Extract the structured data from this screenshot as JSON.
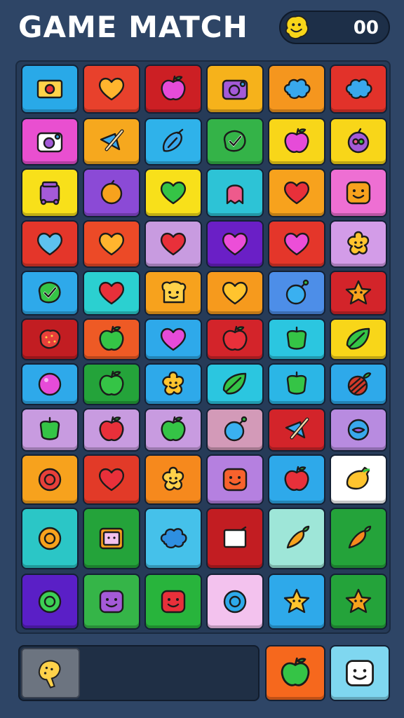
{
  "header": {
    "title": "GAME MATCH",
    "score": "00"
  },
  "colors": {
    "background": "#2e4566",
    "board": "#263b58",
    "text": "#ffffff"
  },
  "board": {
    "rows": [
      [
        {
          "bg": "#29a9e8",
          "icon": "ticket",
          "fg": "#ffd24a"
        },
        {
          "bg": "#e8412c",
          "icon": "heart",
          "fg": "#ffb52e"
        },
        {
          "bg": "#cc1f24",
          "icon": "apple",
          "fg": "#e64bd8"
        },
        {
          "bg": "#f6b21b",
          "icon": "camera",
          "fg": "#a45ad8"
        },
        {
          "bg": "#f5961e",
          "icon": "cloud",
          "fg": "#39a8ec"
        },
        {
          "bg": "#e2322a",
          "icon": "cloud",
          "fg": "#39a8ec"
        }
      ],
      [
        {
          "bg": "#e94fd0",
          "icon": "camera",
          "fg": "#ffffff"
        },
        {
          "bg": "#f6a81e",
          "icon": "brush",
          "fg": "#39a8ec"
        },
        {
          "bg": "#2fb2ea",
          "icon": "bulb",
          "fg": "#39a8ec"
        },
        {
          "bg": "#34b348",
          "icon": "check",
          "fg": "#34b348"
        },
        {
          "bg": "#f8d619",
          "icon": "apple",
          "fg": "#e64bd8"
        },
        {
          "bg": "#f8d619",
          "icon": "plum",
          "fg": "#a45ad8"
        }
      ],
      [
        {
          "bg": "#f8e01a",
          "icon": "bag",
          "fg": "#a45ad8"
        },
        {
          "bg": "#8b4ad6",
          "icon": "orange",
          "fg": "#f7a21d"
        },
        {
          "bg": "#f8e01a",
          "icon": "heart",
          "fg": "#35c446"
        },
        {
          "bg": "#2dc3d6",
          "icon": "ghost",
          "fg": "#ee5a8c"
        },
        {
          "bg": "#f7a21d",
          "icon": "heart",
          "fg": "#e8303a"
        },
        {
          "bg": "#ee6fd3",
          "icon": "face",
          "fg": "#f7a21d"
        }
      ],
      [
        {
          "bg": "#e4362a",
          "icon": "heart",
          "fg": "#5dc1ef"
        },
        {
          "bg": "#ec4a27",
          "icon": "heart",
          "fg": "#ffb52e"
        },
        {
          "bg": "#c89be0",
          "icon": "heart",
          "fg": "#e8303a"
        },
        {
          "bg": "#6a1fc6",
          "icon": "heart",
          "fg": "#ec4ed8"
        },
        {
          "bg": "#e4362a",
          "icon": "heart",
          "fg": "#ec4ed8"
        },
        {
          "bg": "#d39ce8",
          "icon": "flower",
          "fg": "#ffc42e"
        }
      ],
      [
        {
          "bg": "#2ea9ea",
          "icon": "check",
          "fg": "#35c446"
        },
        {
          "bg": "#2bd0d0",
          "icon": "heart",
          "fg": "#e8303a"
        },
        {
          "bg": "#f7a21d",
          "icon": "toast",
          "fg": "#ffd24a"
        },
        {
          "bg": "#f69a1d",
          "icon": "heart",
          "fg": "#ffc42e"
        },
        {
          "bg": "#4d8ee8",
          "icon": "bomb",
          "fg": "#3ab0f0"
        },
        {
          "bg": "#d3242a",
          "icon": "star",
          "fg": "#f7a21d"
        }
      ],
      [
        {
          "bg": "#c21d22",
          "icon": "berry",
          "fg": "#e8403a"
        },
        {
          "bg": "#ee5a25",
          "icon": "apple",
          "fg": "#35c446"
        },
        {
          "bg": "#2ea9ea",
          "icon": "heart",
          "fg": "#e64bd8"
        },
        {
          "bg": "#d3242a",
          "icon": "apple",
          "fg": "#e8303a"
        },
        {
          "bg": "#2bc6e0",
          "icon": "pepper",
          "fg": "#35c446"
        },
        {
          "bg": "#f8d619",
          "icon": "leaf",
          "fg": "#35c446"
        }
      ],
      [
        {
          "bg": "#2ea9ea",
          "icon": "ball",
          "fg": "#e64bd8"
        },
        {
          "bg": "#24a33a",
          "icon": "apple",
          "fg": "#35c446"
        },
        {
          "bg": "#2ea9ea",
          "icon": "flower",
          "fg": "#ffc42e"
        },
        {
          "bg": "#2bc6e0",
          "icon": "leaf",
          "fg": "#35c446"
        },
        {
          "bg": "#2bb6e6",
          "icon": "pepper",
          "fg": "#35c446"
        },
        {
          "bg": "#2ea9ea",
          "icon": "beet",
          "fg": "#d23a2a"
        }
      ],
      [
        {
          "bg": "#c89be0",
          "icon": "pepper",
          "fg": "#35c446"
        },
        {
          "bg": "#c89be0",
          "icon": "apple",
          "fg": "#e8303a"
        },
        {
          "bg": "#c89be0",
          "icon": "apple",
          "fg": "#35c446"
        },
        {
          "bg": "#d39ab8",
          "icon": "bomb",
          "fg": "#3ab0f0"
        },
        {
          "bg": "#d3242a",
          "icon": "brush",
          "fg": "#39a8ec"
        },
        {
          "bg": "#b88be0",
          "icon": "ring",
          "fg": "#39a8ec"
        }
      ],
      [
        {
          "bg": "#f7a21d",
          "icon": "donut",
          "fg": "#e8403a"
        },
        {
          "bg": "#e23a28",
          "icon": "heart",
          "fg": "#e8303a"
        },
        {
          "bg": "#f6891d",
          "icon": "flower",
          "fg": "#ffd24a"
        },
        {
          "bg": "#b580e0",
          "icon": "face",
          "fg": "#f7622d"
        },
        {
          "bg": "#2ea9ea",
          "icon": "apple",
          "fg": "#e8303a"
        },
        {
          "bg": "#ffffff",
          "icon": "lemon",
          "fg": "#ffc42e"
        }
      ],
      [
        {
          "bg": "#2bc6c6",
          "icon": "donut",
          "fg": "#f7a21d"
        },
        {
          "bg": "#24a33a",
          "icon": "screen",
          "fg": "#f7a21d"
        },
        {
          "bg": "#45c1ea",
          "icon": "cloud",
          "fg": "#2e8fe0"
        },
        {
          "bg": "#c21d22",
          "icon": "card",
          "fg": "#ffffff"
        },
        {
          "bg": "#9ee6d8",
          "icon": "carrot",
          "fg": "#f7a21d"
        },
        {
          "bg": "#24a33a",
          "icon": "carrot",
          "fg": "#f7881d"
        }
      ],
      [
        {
          "bg": "#5a1fc6",
          "icon": "donut",
          "fg": "#3dcf55"
        },
        {
          "bg": "#35b548",
          "icon": "face",
          "fg": "#a45ad8"
        },
        {
          "bg": "#28b43c",
          "icon": "face",
          "fg": "#e8303a"
        },
        {
          "bg": "#f3c2ee",
          "icon": "donut",
          "fg": "#2ea9ea"
        },
        {
          "bg": "#2ea9ea",
          "icon": "star",
          "fg": "#ffc42e"
        },
        {
          "bg": "#24a33a",
          "icon": "star",
          "fg": "#f7a21d"
        }
      ]
    ]
  },
  "tray": {
    "slot_icon": "lemon",
    "slot_icon_color": "#ffd24a"
  },
  "actions": [
    {
      "bg": "#f6681d",
      "icon": "apple",
      "fg": "#35c446"
    },
    {
      "bg": "#7fd7f0",
      "icon": "face",
      "fg": "#ffffff"
    }
  ]
}
